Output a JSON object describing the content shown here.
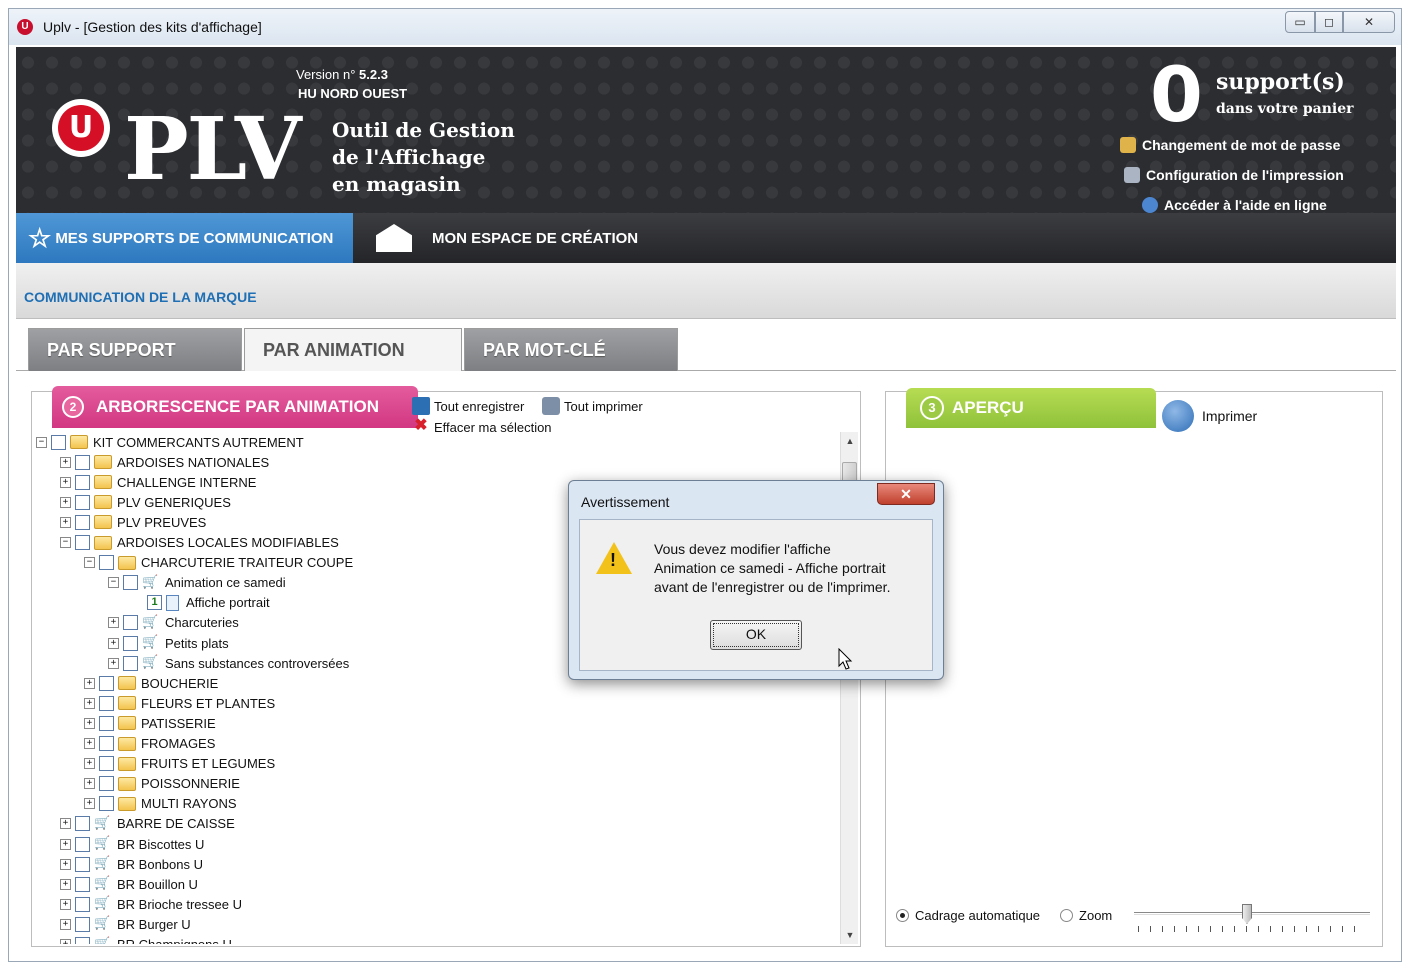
{
  "window": {
    "title": "Uplv - [Gestion des kits d'affichage]",
    "logo_letter": "U",
    "buttons": {
      "minimize": "▭",
      "maximize": "◻",
      "close": "✕"
    }
  },
  "header": {
    "logo_letter": "U",
    "brand": "PLV",
    "tagline": [
      "Outil de Gestion",
      "de l'Affichage",
      "en magasin"
    ],
    "version_label": "Version n°",
    "version": "5.2.3",
    "store": "HU NORD OUEST",
    "cart_count": "0",
    "cart_label": "support(s)",
    "cart_sub": "dans votre panier",
    "links": [
      "Changement de mot de passe",
      "Configuration de l'impression",
      "Accéder à l'aide en ligne"
    ]
  },
  "nav": {
    "tab1": "MES SUPPORTS DE COMMUNICATION",
    "tab2": "MON ESPACE DE CRÉATION",
    "star": "☆"
  },
  "subbar": {
    "label": "COMMUNICATION DE LA MARQUE"
  },
  "tabs": [
    "PAR SUPPORT",
    "PAR ANIMATION",
    "PAR MOT-CLÉ"
  ],
  "left": {
    "step": "2",
    "title": "ARBORESCENCE PAR ANIMATION",
    "actions": {
      "save_all": "Tout enregistrer",
      "print_all": "Tout imprimer",
      "clear": "Effacer ma sélection",
      "clear_icon": "✖"
    },
    "tree": [
      {
        "label": "KIT COMMERCANTS AUTREMENT",
        "level": 0,
        "exp": "−",
        "icon": "folder"
      },
      {
        "label": "ARDOISES NATIONALES",
        "level": 1,
        "exp": "+",
        "icon": "folder"
      },
      {
        "label": "CHALLENGE INTERNE",
        "level": 1,
        "exp": "+",
        "icon": "folder"
      },
      {
        "label": "PLV GENERIQUES",
        "level": 1,
        "exp": "+",
        "icon": "folder"
      },
      {
        "label": "PLV PREUVES",
        "level": 1,
        "exp": "+",
        "icon": "folder"
      },
      {
        "label": "ARDOISES LOCALES MODIFIABLES",
        "level": 1,
        "exp": "−",
        "icon": "folder"
      },
      {
        "label": "CHARCUTERIE TRAITEUR COUPE",
        "level": 2,
        "exp": "−",
        "icon": "folder"
      },
      {
        "label": "Animation ce samedi",
        "level": 3,
        "exp": "−",
        "icon": "cart"
      },
      {
        "label": "Affiche portrait",
        "level": 4,
        "exp": "",
        "icon": "doc",
        "count": "1"
      },
      {
        "label": "Charcuteries",
        "level": 3,
        "exp": "+",
        "icon": "cart"
      },
      {
        "label": "Petits plats",
        "level": 3,
        "exp": "+",
        "icon": "cart"
      },
      {
        "label": "Sans substances controversées",
        "level": 3,
        "exp": "+",
        "icon": "cart"
      },
      {
        "label": "BOUCHERIE",
        "level": 2,
        "exp": "+",
        "icon": "folder"
      },
      {
        "label": "FLEURS ET PLANTES",
        "level": 2,
        "exp": "+",
        "icon": "folder"
      },
      {
        "label": "PATISSERIE",
        "level": 2,
        "exp": "+",
        "icon": "folder"
      },
      {
        "label": "FROMAGES",
        "level": 2,
        "exp": "+",
        "icon": "folder"
      },
      {
        "label": "FRUITS ET LEGUMES",
        "level": 2,
        "exp": "+",
        "icon": "folder"
      },
      {
        "label": "POISSONNERIE",
        "level": 2,
        "exp": "+",
        "icon": "folder"
      },
      {
        "label": "MULTI RAYONS",
        "level": 2,
        "exp": "+",
        "icon": "folder"
      },
      {
        "label": "BARRE DE CAISSE",
        "level": 1,
        "exp": "+",
        "icon": "cart"
      },
      {
        "label": "BR Biscottes U",
        "level": 1,
        "exp": "+",
        "icon": "cart"
      },
      {
        "label": "BR Bonbons U",
        "level": 1,
        "exp": "+",
        "icon": "cart"
      },
      {
        "label": "BR Bouillon U",
        "level": 1,
        "exp": "+",
        "icon": "cart"
      },
      {
        "label": "BR Brioche tressee U",
        "level": 1,
        "exp": "+",
        "icon": "cart"
      },
      {
        "label": "BR Burger U",
        "level": 1,
        "exp": "+",
        "icon": "cart"
      },
      {
        "label": "BR Champignons U",
        "level": 1,
        "exp": "+",
        "icon": "cart"
      }
    ],
    "scroll": {
      "up": "▲",
      "down": "▼"
    }
  },
  "right": {
    "step": "3",
    "title": "APERÇU",
    "print_label": "Imprimer",
    "fit_label": "Cadrage automatique",
    "zoom_label": "Zoom",
    "zoom_level": 0.48
  },
  "dialog": {
    "title": "Avertissement",
    "close": "✕",
    "warn_glyph": "!",
    "message": [
      "Vous devez modifier l'affiche",
      "Animation ce samedi - Affiche portrait",
      "avant de l'enregistrer ou de l'imprimer."
    ],
    "ok": "OK"
  }
}
